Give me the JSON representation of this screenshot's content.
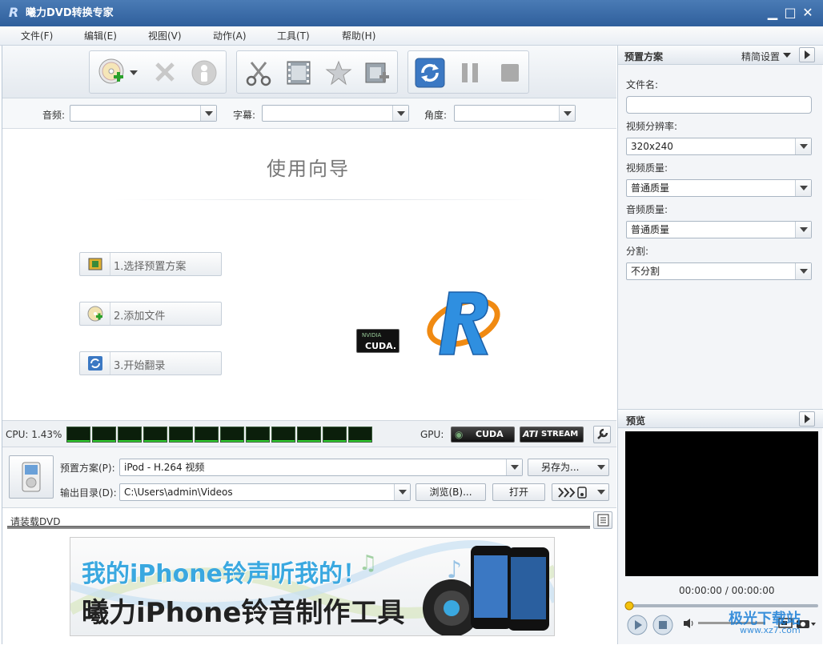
{
  "titlebar": {
    "title": "曦力DVD转换专家",
    "logo": "R",
    "minimize": "▁",
    "maximize": "□",
    "close": "✕"
  },
  "menu": [
    "文件(F)",
    "编辑(E)",
    "视图(V)",
    "动作(A)",
    "工具(T)",
    "帮助(H)"
  ],
  "selectors": {
    "audio_label": "音频:",
    "subtitle_label": "字幕:",
    "angle_label": "角度:"
  },
  "wizard": {
    "title": "使用向导",
    "steps": [
      "1.选择预置方案",
      "2.添加文件",
      "3.开始翻录"
    ],
    "cuda_top": "NVIDIA",
    "cuda_bottom": "CUDA."
  },
  "cpu": {
    "label": "CPU: 1.43%",
    "gpu_label": "GPU:",
    "cuda": "CUDA",
    "ati": "ATI",
    "stream": "STREAM"
  },
  "output": {
    "preset_label": "预置方案(P):",
    "preset_value": "iPod - H.264 视频",
    "saveas_label": "另存为...",
    "dir_label": "输出目录(D):",
    "dir_value": "C:\\Users\\admin\\Videos",
    "browse_label": "浏览(B)...",
    "open_label": "打开"
  },
  "status": {
    "text": "请装载DVD"
  },
  "banner": {
    "line1": "我的iPhone铃声听我的！",
    "line2": "曦力iPhone铃音制作工具"
  },
  "right": {
    "preset_head": "预置方案",
    "simple_settings": "精简设置",
    "filename_label": "文件名:",
    "filename_value": "",
    "resolution_label": "视频分辨率:",
    "resolution_value": "320x240",
    "vquality_label": "视频质量:",
    "vquality_value": "普通质量",
    "aquality_label": "音频质量:",
    "aquality_value": "普通质量",
    "split_label": "分割:",
    "split_value": "不分割",
    "preview_head": "预览",
    "time": "00:00:00 / 00:00:00"
  },
  "watermark": {
    "text": "极光下载站",
    "url": "www.xz7.com"
  }
}
